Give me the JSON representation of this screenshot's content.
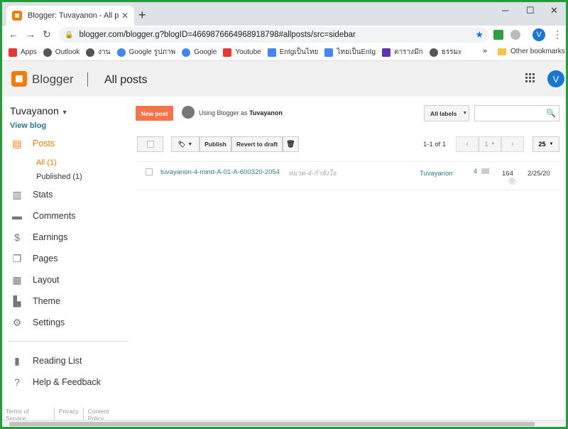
{
  "browser": {
    "tab_title": "Blogger: Tuvayanon - All posts",
    "url": "blogger.com/blogger.g?blogID=4669876664968918798#allposts/src=sidebar",
    "profile_initial": "V"
  },
  "bookmarks": {
    "items": [
      {
        "label": "Apps",
        "color": "#e53935"
      },
      {
        "label": "Outlook",
        "color": "#555555"
      },
      {
        "label": "งาน",
        "color": "#555555"
      },
      {
        "label": "Google รูปภาพ",
        "color": "#4285f4"
      },
      {
        "label": "Google",
        "color": "#4285f4"
      },
      {
        "label": "Youtube",
        "color": "#e53935"
      },
      {
        "label": "Entgเป็นไทย",
        "color": "#4285f4"
      },
      {
        "label": "ไทยเป็นEntg",
        "color": "#4285f4"
      },
      {
        "label": "ตารางมึก",
        "color": "#5e35b1"
      },
      {
        "label": "ธรรมะ",
        "color": "#555555"
      }
    ],
    "more": "»",
    "other": "Other bookmarks"
  },
  "header": {
    "brand": "Blogger",
    "page_title": "All posts",
    "avatar_initial": "V"
  },
  "sidebar": {
    "blog_name": "Tuvayanon",
    "view_blog": "View blog",
    "nav": [
      {
        "label": "Posts",
        "icon": "posts-icon"
      },
      {
        "label": "Stats",
        "icon": "stats-icon"
      },
      {
        "label": "Comments",
        "icon": "comments-icon"
      },
      {
        "label": "Earnings",
        "icon": "earnings-icon"
      },
      {
        "label": "Pages",
        "icon": "pages-icon"
      },
      {
        "label": "Layout",
        "icon": "layout-icon"
      },
      {
        "label": "Theme",
        "icon": "theme-icon"
      },
      {
        "label": "Settings",
        "icon": "settings-icon"
      },
      {
        "label": "Reading List",
        "icon": "reading-list-icon"
      },
      {
        "label": "Help & Feedback",
        "icon": "help-icon"
      }
    ],
    "sub": {
      "all": "All (1)",
      "published": "Published (1)"
    },
    "footer": [
      "Terms of Service",
      "Privacy",
      "Content Policy"
    ]
  },
  "main": {
    "new_post": "New post",
    "using_prefix": "Using Blogger as",
    "using_user": "Tuvayanon",
    "labels_select": "All labels",
    "toolbar": {
      "publish": "Publish",
      "revert": "Revert to draft"
    },
    "range": "1-1 of 1",
    "page": "1",
    "per_page": "25",
    "posts": [
      {
        "title": "tuvayanon-4-mind-A-01-A-600320-2054",
        "label": "หมวด-4-กำลังใจ",
        "author": "Tuvayanon",
        "comments": "4",
        "views": "164",
        "date": "2/25/20"
      }
    ]
  }
}
